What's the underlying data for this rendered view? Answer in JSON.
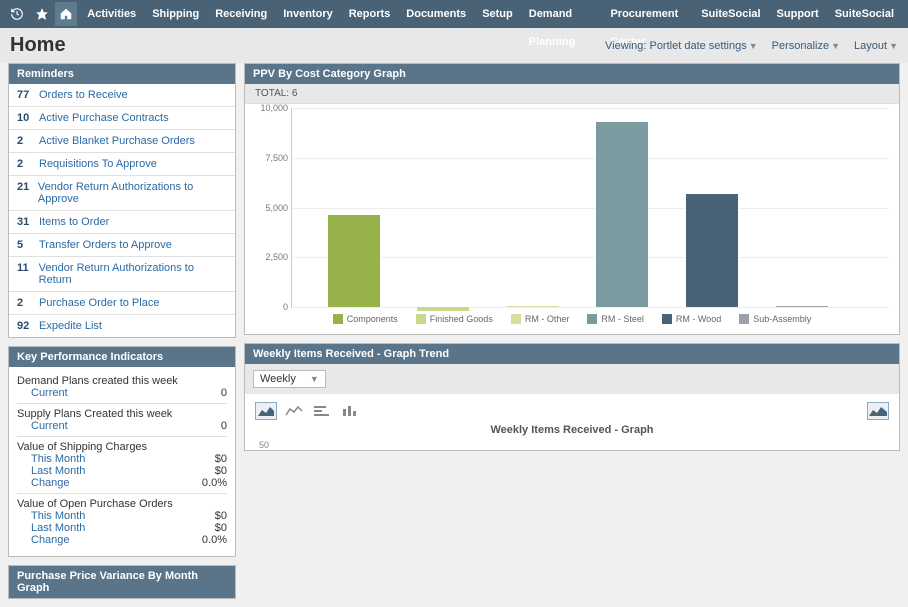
{
  "nav": {
    "items": [
      "Activities",
      "Shipping",
      "Receiving",
      "Inventory",
      "Reports",
      "Documents",
      "Setup",
      "Demand Planning",
      "Procurement Center",
      "SuiteSocial",
      "Support",
      "SuiteSocial"
    ]
  },
  "header": {
    "title": "Home",
    "viewing": "Viewing: Portlet date settings",
    "personalize": "Personalize",
    "layout": "Layout"
  },
  "reminders": {
    "title": "Reminders",
    "items": [
      {
        "count": "77",
        "label": "Orders to Receive"
      },
      {
        "count": "10",
        "label": "Active Purchase Contracts"
      },
      {
        "count": "2",
        "label": "Active Blanket Purchase Orders"
      },
      {
        "count": "2",
        "label": "Requisitions To Approve"
      },
      {
        "count": "21",
        "label": "Vendor Return Authorizations to Approve"
      },
      {
        "count": "31",
        "label": "Items to Order"
      },
      {
        "count": "5",
        "label": "Transfer Orders to Approve"
      },
      {
        "count": "11",
        "label": "Vendor Return Authorizations to Return"
      },
      {
        "count": "2",
        "label": "Purchase Order to Place"
      },
      {
        "count": "92",
        "label": "Expedite List"
      }
    ]
  },
  "kpi": {
    "title": "Key Performance Indicators",
    "groups": [
      {
        "title": "Demand Plans created this week",
        "lines": [
          {
            "label": "Current",
            "value": "0"
          }
        ]
      },
      {
        "title": "Supply Plans Created this week",
        "lines": [
          {
            "label": "Current",
            "value": "0"
          }
        ]
      },
      {
        "title": "Value of Shipping Charges",
        "lines": [
          {
            "label": "This Month",
            "value": "$0"
          },
          {
            "label": "Last Month",
            "value": "$0"
          },
          {
            "label": "Change",
            "value": "0.0%"
          }
        ]
      },
      {
        "title": "Value of Open Purchase Orders",
        "lines": [
          {
            "label": "This Month",
            "value": "$0"
          },
          {
            "label": "Last Month",
            "value": "$0"
          },
          {
            "label": "Change",
            "value": "0.0%"
          }
        ]
      }
    ]
  },
  "ppv_month": {
    "title": "Purchase Price Variance By Month Graph"
  },
  "ppv": {
    "title": "PPV By Cost Category Graph",
    "total": "TOTAL: 6"
  },
  "chart_data": {
    "type": "bar",
    "categories": [
      "Components",
      "Finished Goods",
      "RM - Other",
      "RM - Steel",
      "RM - Wood",
      "Sub-Assembly"
    ],
    "values": [
      4600,
      -200,
      50,
      9300,
      5700,
      0
    ],
    "colors": [
      "#97b24a",
      "#c6d98d",
      "#d9dea0",
      "#7a9ba0",
      "#4a6275",
      "#9aa3ab"
    ],
    "title": "PPV By Cost Category Graph",
    "xlabel": "",
    "ylabel": "",
    "ylim": [
      0,
      10000
    ],
    "yticks": [
      0,
      2500,
      5000,
      7500,
      10000
    ]
  },
  "trend": {
    "title": "Weekly Items Received - Graph Trend",
    "dropdown": "Weekly",
    "subtitle": "Weekly Items Received - Graph",
    "y0": "50"
  }
}
